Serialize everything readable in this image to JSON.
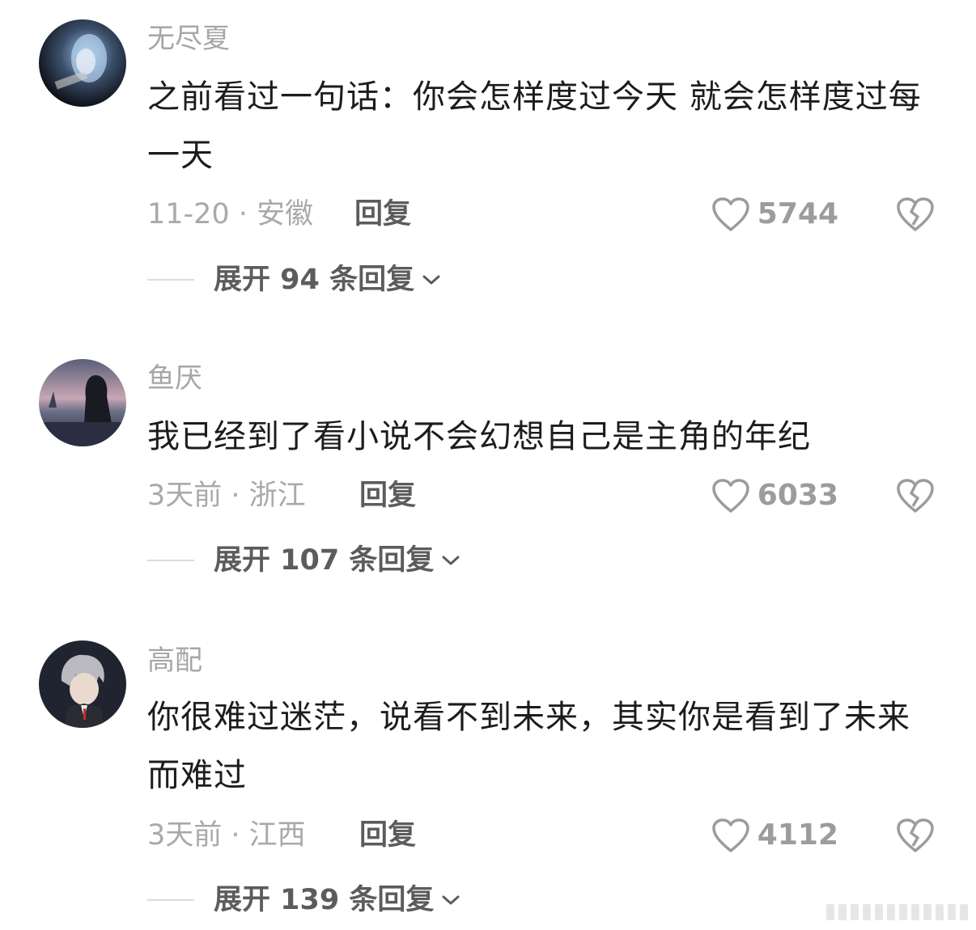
{
  "comments": [
    {
      "username": "无尽夏",
      "text": "之前看过一句话：你会怎样度过今天 就会怎样度过每一天",
      "meta": "11-20 · 安徽",
      "reply_label": "回复",
      "likes": "5744",
      "expand_label": "展开 94 条回复"
    },
    {
      "username": "鱼厌",
      "text": "我已经到了看小说不会幻想自己是主角的年纪",
      "meta": "3天前 · 浙江",
      "reply_label": "回复",
      "likes": "6033",
      "expand_label": "展开 107 条回复"
    },
    {
      "username": "高配",
      "text": "你很难过迷茫，说看不到未来，其实你是看到了未来而难过",
      "meta": "3天前 · 江西",
      "reply_label": "回复",
      "likes": "4112",
      "expand_label": "展开 139 条回复"
    }
  ],
  "icons": {
    "like": "heart-outline-icon",
    "dislike": "broken-heart-icon",
    "expand": "chevron-down-icon"
  }
}
